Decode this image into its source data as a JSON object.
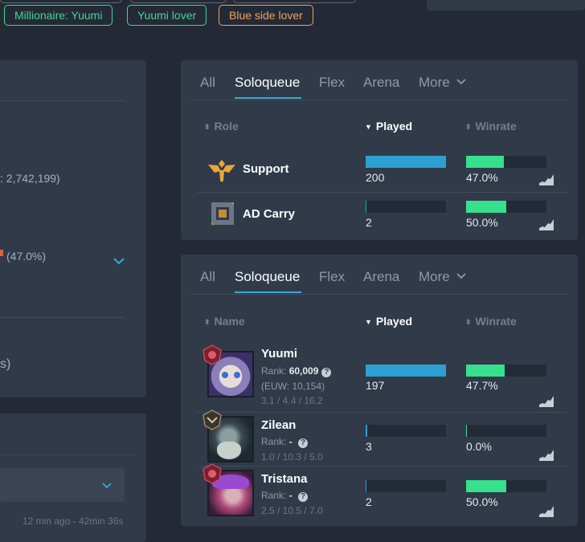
{
  "tags": [
    {
      "label": "Millionaire: Yuumi",
      "color": "#46d694"
    },
    {
      "label": "Yuumi lover",
      "color": "#46d694"
    },
    {
      "label": "Blue side lover",
      "color": "#f0a35e"
    }
  ],
  "left_panel": {
    "points_total": ": 2,742,199)",
    "winrate": "(47.0%)",
    "partial_text": "s)",
    "timestamp": "12 min ago - 42min 36s"
  },
  "tabs": [
    "All",
    "Soloqueue",
    "Flex",
    "Arena",
    "More"
  ],
  "roles": {
    "headers": {
      "role": "Role",
      "played": "Played",
      "winrate": "Winrate"
    },
    "rows": [
      {
        "name": "Support",
        "icon": "support-role-icon",
        "played": 200,
        "played_fraction": 1.0,
        "winrate": "47.0%",
        "winrate_value": 47.0
      },
      {
        "name": "AD Carry",
        "icon": "adc-role-icon",
        "played": 2,
        "played_fraction": 0.01,
        "winrate": "50.0%",
        "winrate_value": 50.0
      }
    ]
  },
  "champions": {
    "headers": {
      "name": "Name",
      "played": "Played",
      "winrate": "Winrate"
    },
    "rows": [
      {
        "name": "Yuumi",
        "rank_label": "Rank:",
        "rank": "60,009",
        "region": "(EUW: 10,154)",
        "kda": "3.1 / 4.4 / 16.2",
        "played": 197,
        "played_fraction": 1.0,
        "winrate": "47.7%",
        "winrate_value": 47.7
      },
      {
        "name": "Zilean",
        "rank_label": "Rank:",
        "rank": "-",
        "kda": "1.0 / 10.3 / 5.0",
        "played": 3,
        "played_fraction": 0.015,
        "winrate": "0.0%",
        "winrate_value": 0.0
      },
      {
        "name": "Tristana",
        "rank_label": "Rank:",
        "rank": "-",
        "kda": "2.5 / 10.5 / 7.0",
        "played": 2,
        "played_fraction": 0.01,
        "winrate": "50.0%",
        "winrate_value": 50.0
      }
    ]
  },
  "colors": {
    "accent": "#2e9fd2",
    "winrate_fill": "#36e08c",
    "tag_green": "#46d694",
    "tag_orange": "#f0a35e"
  }
}
